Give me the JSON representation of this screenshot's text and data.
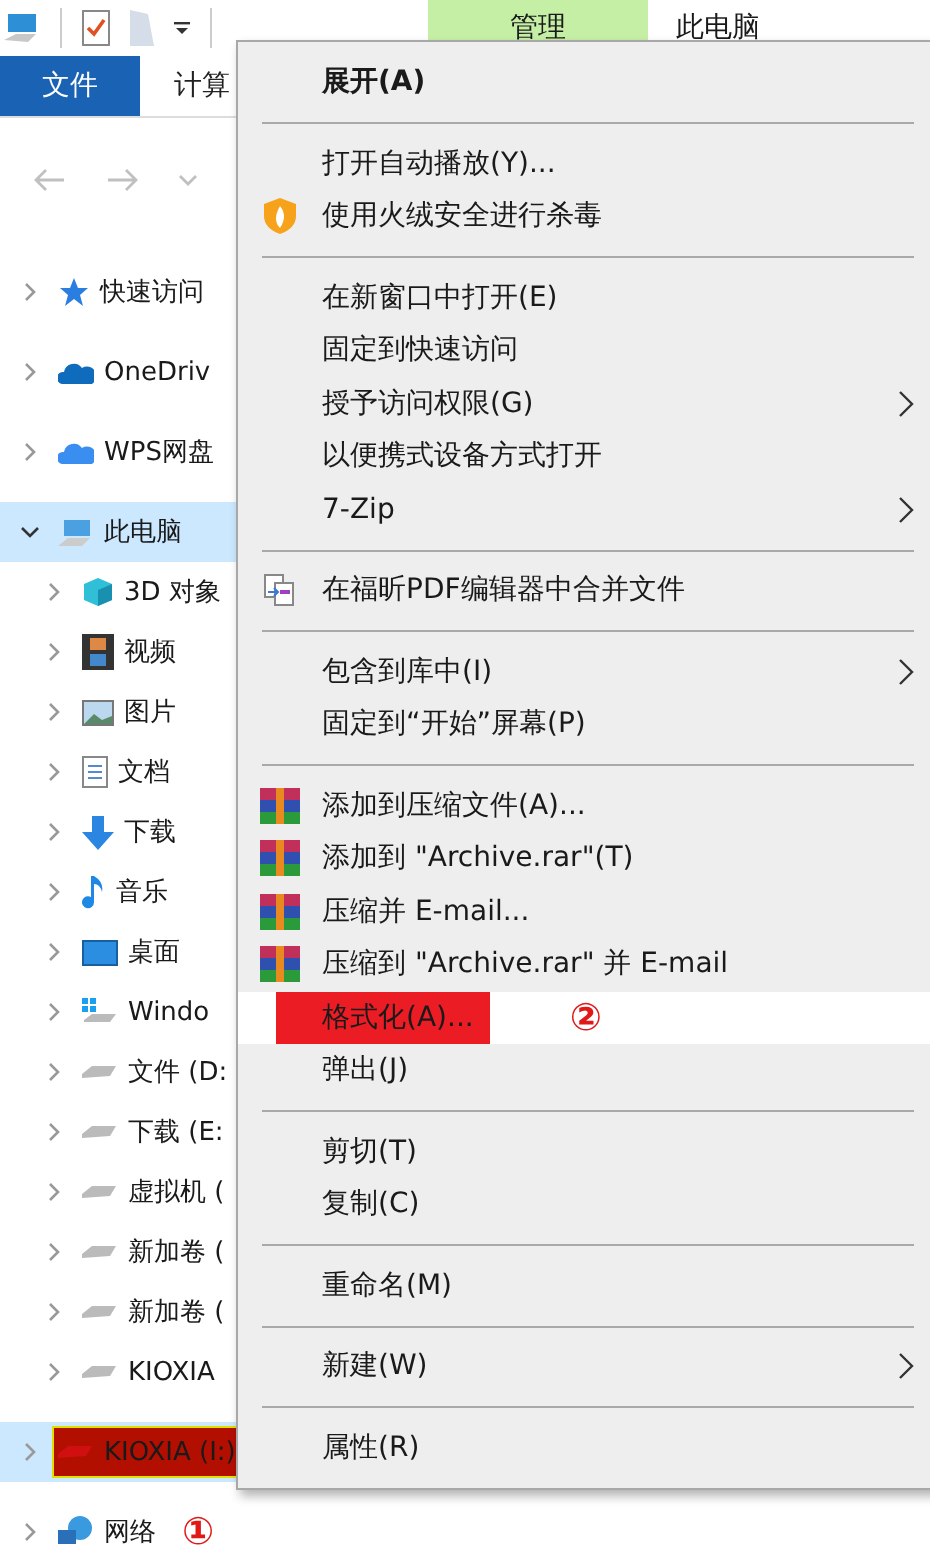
{
  "title_bar": {
    "tabs": [
      {
        "label": "管理",
        "kind": "context"
      },
      {
        "label": "此电脑",
        "kind": "title"
      }
    ]
  },
  "ribbon": {
    "tabs": [
      {
        "label": "文件",
        "kind": "file"
      },
      {
        "label": "计算",
        "kind": "tab"
      }
    ]
  },
  "tree": [
    {
      "label": "快速访问",
      "expanded": false,
      "selected": false
    },
    {
      "label": "OneDriv",
      "expanded": false,
      "selected": false
    },
    {
      "label": "WPS网盘",
      "expanded": false,
      "selected": false
    },
    {
      "label": "此电脑",
      "expanded": true,
      "selected": true,
      "children": [
        {
          "label": "3D 对象",
          "expanded": false,
          "selected": false
        },
        {
          "label": "视频",
          "expanded": false,
          "selected": false
        },
        {
          "label": "图片",
          "expanded": false,
          "selected": false
        },
        {
          "label": "文档",
          "expanded": false,
          "selected": false
        },
        {
          "label": "下载",
          "expanded": false,
          "selected": false
        },
        {
          "label": "音乐",
          "expanded": false,
          "selected": false
        },
        {
          "label": "桌面",
          "expanded": false,
          "selected": false
        },
        {
          "label": "Windo",
          "expanded": false,
          "selected": false
        },
        {
          "label": "文件 (D:",
          "expanded": false,
          "selected": false
        },
        {
          "label": "下载 (E:",
          "expanded": false,
          "selected": false
        },
        {
          "label": "虚拟机 (",
          "expanded": false,
          "selected": false
        },
        {
          "label": "新加卷 (",
          "expanded": false,
          "selected": false
        },
        {
          "label": "新加卷 (",
          "expanded": false,
          "selected": false
        },
        {
          "label": "KIOXIA",
          "expanded": false,
          "selected": false
        }
      ]
    },
    {
      "label": "KIOXIA (I:)",
      "expanded": false,
      "selected": true,
      "marked": true
    },
    {
      "label": "网络",
      "expanded": false,
      "selected": false,
      "note": "①"
    }
  ],
  "context_menu": [
    {
      "kind": "item",
      "label": "展开(A)",
      "bold": true
    },
    {
      "kind": "separator"
    },
    {
      "kind": "item",
      "label": "打开自动播放(Y)..."
    },
    {
      "kind": "item",
      "label": "使用火绒安全进行杀毒"
    },
    {
      "kind": "separator"
    },
    {
      "kind": "item",
      "label": "在新窗口中打开(E)"
    },
    {
      "kind": "item",
      "label": "固定到快速访问"
    },
    {
      "kind": "item",
      "label": "授予访问权限(G)",
      "submenu": true
    },
    {
      "kind": "item",
      "label": "以便携式设备方式打开"
    },
    {
      "kind": "item",
      "label": "7-Zip",
      "submenu": true
    },
    {
      "kind": "separator"
    },
    {
      "kind": "item",
      "label": "在福昕PDF编辑器中合并文件"
    },
    {
      "kind": "separator"
    },
    {
      "kind": "item",
      "label": "包含到库中(I)",
      "submenu": true
    },
    {
      "kind": "item",
      "label": "固定到“开始”屏幕(P)"
    },
    {
      "kind": "separator"
    },
    {
      "kind": "item",
      "label": "添加到压缩文件(A)..."
    },
    {
      "kind": "item",
      "label": "添加到 \"Archive.rar\"(T)"
    },
    {
      "kind": "item",
      "label": "压缩并 E-mail..."
    },
    {
      "kind": "item",
      "label": "压缩到 \"Archive.rar\" 并 E-mail"
    },
    {
      "kind": "item",
      "label": "格式化(A)...",
      "highlighted": true,
      "marked": true,
      "note": "②"
    },
    {
      "kind": "item",
      "label": "弹出(J)"
    },
    {
      "kind": "separator"
    },
    {
      "kind": "item",
      "label": "剪切(T)"
    },
    {
      "kind": "item",
      "label": "复制(C)"
    },
    {
      "kind": "separator"
    },
    {
      "kind": "item",
      "label": "重命名(M)"
    },
    {
      "kind": "separator"
    },
    {
      "kind": "item",
      "label": "新建(W)",
      "submenu": true
    },
    {
      "kind": "separator"
    },
    {
      "kind": "item",
      "label": "属性(R)"
    }
  ]
}
